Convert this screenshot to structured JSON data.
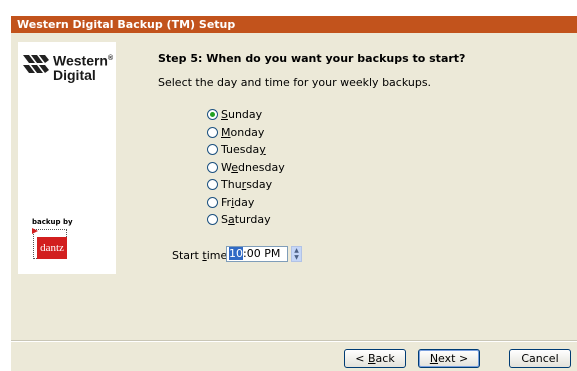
{
  "window": {
    "title": "Western Digital Backup (TM) Setup"
  },
  "logo": {
    "brand_line1": "Western",
    "brand_line2": "Digital",
    "registered": "®"
  },
  "backup_logo": {
    "by_text": "backup by",
    "brand": "dantz"
  },
  "step": {
    "title": "Step 5: When do you want your backups to start?",
    "description": "Select the day and time for your weekly backups."
  },
  "days": [
    {
      "label": "Sunday",
      "pre": "",
      "key": "S",
      "post": "unday",
      "selected": true
    },
    {
      "label": "Monday",
      "pre": "",
      "key": "M",
      "post": "onday",
      "selected": false
    },
    {
      "label": "Tuesday",
      "pre": "Tuesda",
      "key": "y",
      "post": "",
      "selected": false
    },
    {
      "label": "Wednesday",
      "pre": "W",
      "key": "e",
      "post": "dnesday",
      "selected": false
    },
    {
      "label": "Thursday",
      "pre": "Thu",
      "key": "r",
      "post": "sday",
      "selected": false
    },
    {
      "label": "Friday",
      "pre": "Fr",
      "key": "i",
      "post": "day",
      "selected": false
    },
    {
      "label": "Saturday",
      "pre": "S",
      "key": "a",
      "post": "turday",
      "selected": false
    }
  ],
  "start_time": {
    "label_pre": "Start ",
    "label_key": "t",
    "label_post": "ime:",
    "hour": "10",
    "rest": ":00 PM"
  },
  "buttons": {
    "back": {
      "pre": "< ",
      "key": "B",
      "post": "ack"
    },
    "next": {
      "pre": "",
      "key": "N",
      "post": "ext >"
    },
    "cancel": "Cancel"
  },
  "colors": {
    "title_bar": "#c2531c",
    "dialog_bg": "#ece9d8",
    "dantz_red": "#d21f1f"
  }
}
